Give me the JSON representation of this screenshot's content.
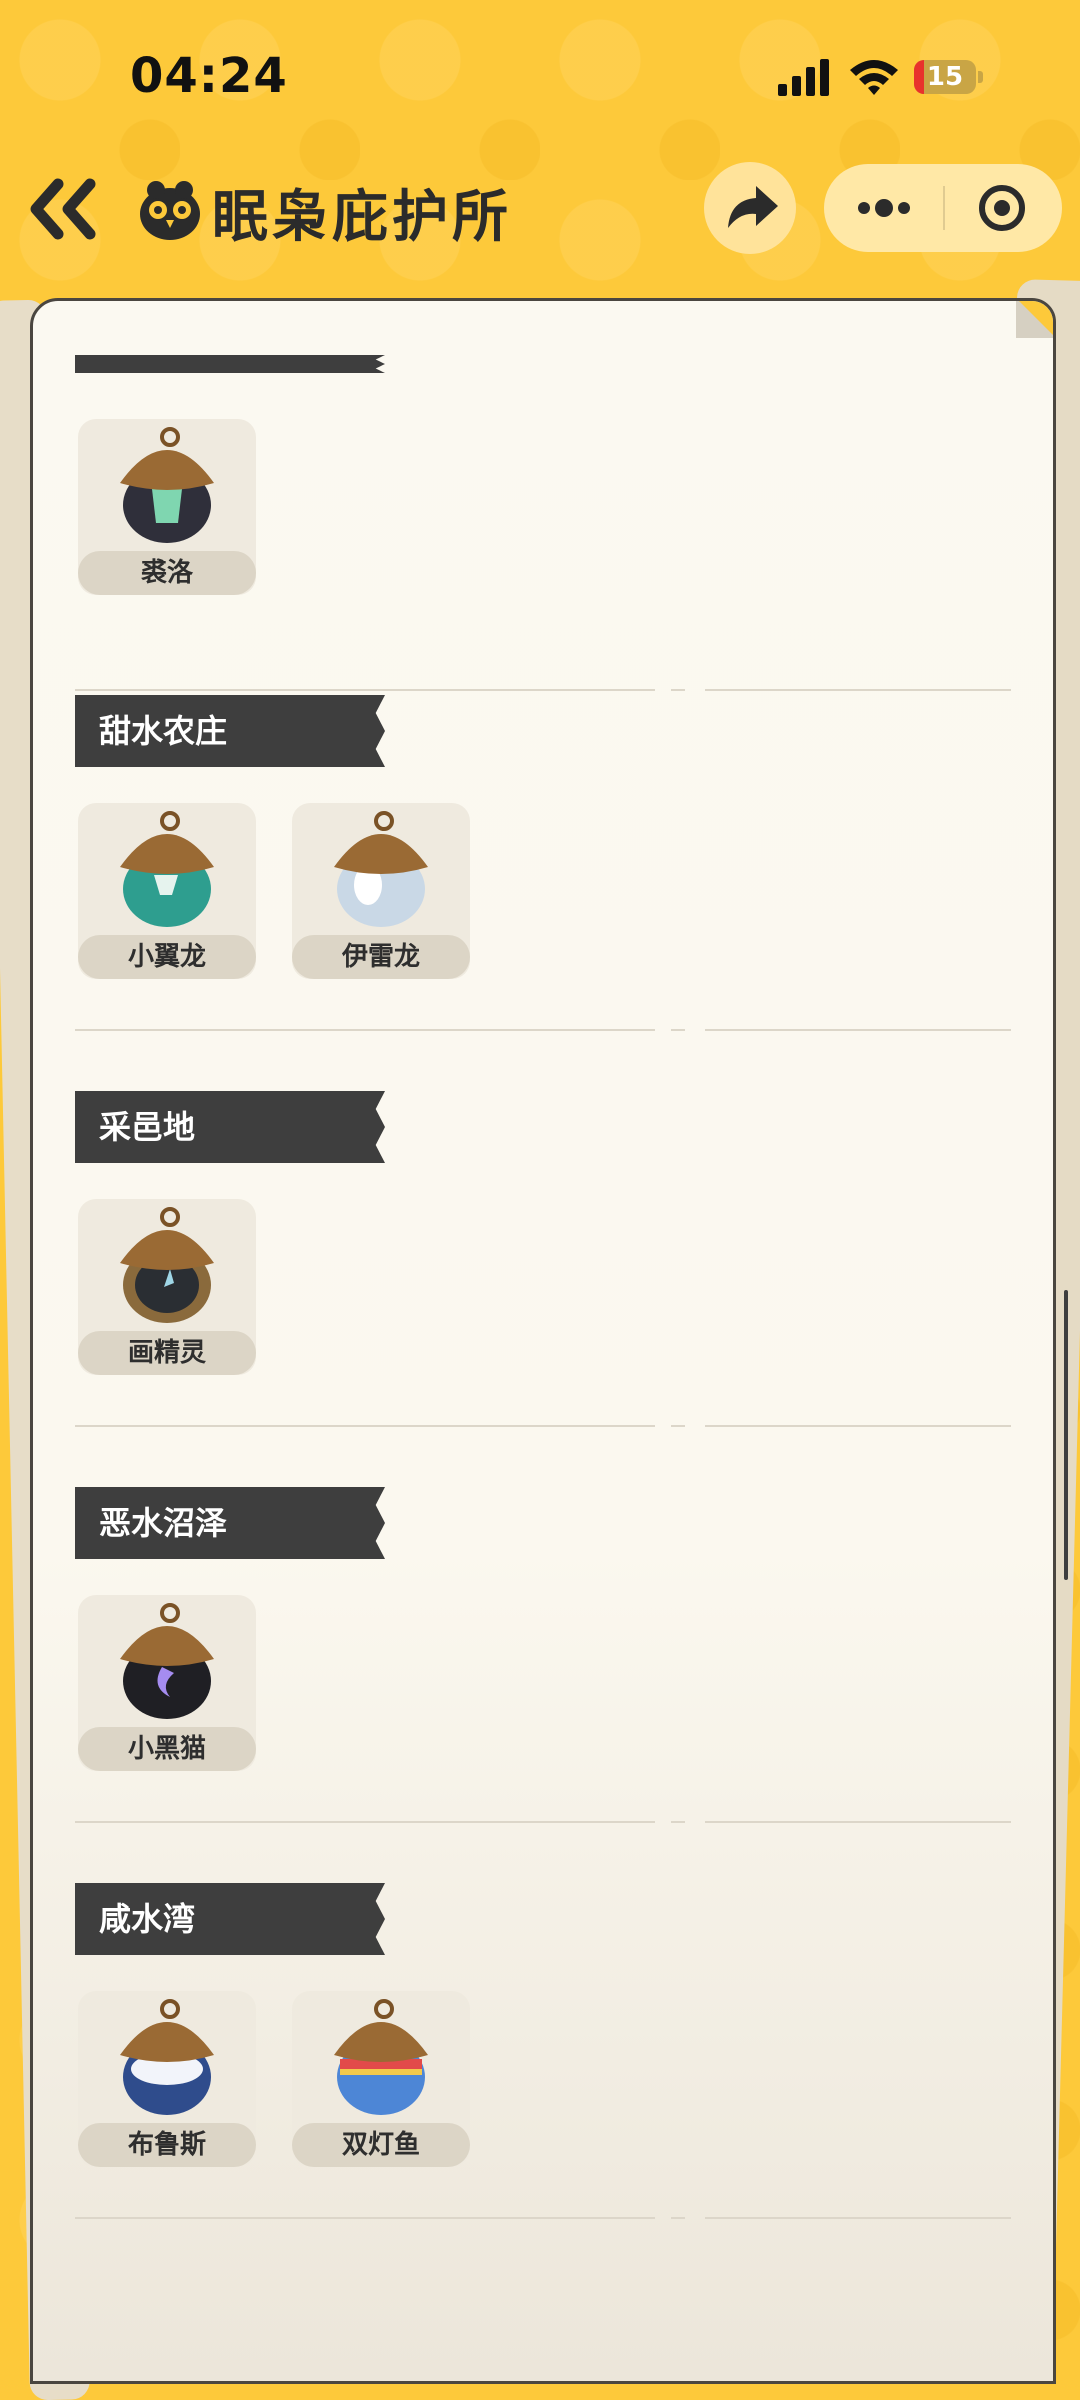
{
  "status_bar": {
    "time": "04:24",
    "battery_level": "15",
    "icons": [
      "signal-icon",
      "wifi-icon",
      "battery-charging-icon"
    ]
  },
  "nav": {
    "title": "眠枭庇护所",
    "back_icon": "double-chevron-left-icon",
    "logo_icon": "owl-logo-icon",
    "share_icon": "share-arrow-icon",
    "more_icon": "more-dots-icon",
    "close_icon": "target-circle-icon"
  },
  "sections": [
    {
      "title": "",
      "items": [
        {
          "label": "裘洛",
          "color": "#2F2F3A",
          "accent": "#7FD6B0"
        }
      ]
    },
    {
      "title": "甜水农庄",
      "items": [
        {
          "label": "小翼龙",
          "color": "#2E9E8F",
          "accent": "#E6F3EE"
        },
        {
          "label": "伊雷龙",
          "color": "#C9D8E6",
          "accent": "#FFFFFF"
        }
      ]
    },
    {
      "title": "采邑地",
      "items": [
        {
          "label": "画精灵",
          "color": "#2A2E33",
          "accent": "#9FD6E6"
        }
      ]
    },
    {
      "title": "恶水沼泽",
      "items": [
        {
          "label": "小黑猫",
          "color": "#1F1F24",
          "accent": "#A58CF0"
        }
      ]
    },
    {
      "title": "咸水湾",
      "items": [
        {
          "label": "布鲁斯",
          "color": "#2F4C8C",
          "accent": "#F2F4FA"
        },
        {
          "label": "双灯鱼",
          "color": "#4D86D6",
          "accent": "#E24A4A"
        }
      ]
    }
  ],
  "colors": {
    "background": "#FDC93A",
    "paper": "#FBF9F1",
    "header_band": "#3E3E3E",
    "card": "#EFEADF"
  }
}
